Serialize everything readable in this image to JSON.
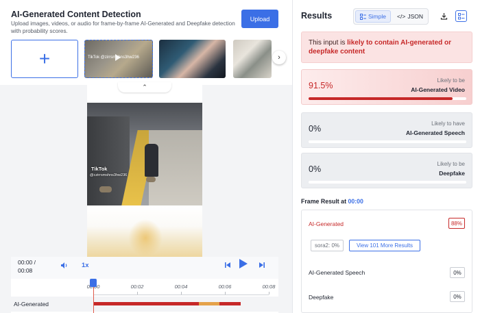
{
  "header": {
    "title": "AI-Generated Content Detection",
    "subtitle": "Upload images, videos, or audio for frame-by-frame AI-Generated and Deepfake detection with probability scores.",
    "upload_label": "Upload"
  },
  "thumbnails": {
    "add_symbol": "+",
    "first_label": "TikTok @zirrsmshns3hw236",
    "next_symbol": "›"
  },
  "video": {
    "overlay_brand": "TikTok",
    "overlay_user": "@czirrsmshns3hw236",
    "collapse_symbol": "⌃"
  },
  "controls": {
    "time_current": "00:00 /",
    "time_total": "00:08",
    "speed": "1x"
  },
  "timeline": {
    "ticks": [
      "00:00",
      "00:02",
      "00:04",
      "00:06",
      "00:08"
    ],
    "track_label": "AI-Generated",
    "segments": [
      {
        "start": 0.0,
        "end": 0.6,
        "color": "#c62828"
      },
      {
        "start": 0.6,
        "end": 0.72,
        "color": "#e5a24a"
      },
      {
        "start": 0.72,
        "end": 0.84,
        "color": "#c62828"
      }
    ]
  },
  "results": {
    "title": "Results",
    "toggle_simple": "Simple",
    "toggle_json": "JSON",
    "alert_prefix": "This input is ",
    "alert_bold": "likely to contain AI-generated or deepfake content",
    "cards": [
      {
        "value": "91.5%",
        "small": "Likely to be",
        "big": "AI-Generated Video",
        "fill": 0.915
      },
      {
        "value": "0%",
        "small": "Likely to have",
        "big": "AI-Generated Speech",
        "fill": 0
      },
      {
        "value": "0%",
        "small": "Likely to be",
        "big": "Deepfake",
        "fill": 0
      }
    ]
  },
  "frame": {
    "title_prefix": "Frame Result at ",
    "title_time": "00:00",
    "ai_label": "AI-Generated",
    "ai_pct": "88%",
    "chip_model": "sora2: 0%",
    "chip_more": "View 101 More Results",
    "speech_label": "AI-Generated Speech",
    "speech_pct": "0%",
    "deepfake_label": "Deepfake",
    "deepfake_pct": "0%"
  },
  "colors": {
    "accent": "#3b6fe6",
    "danger": "#c62828",
    "warning": "#e5a24a"
  }
}
